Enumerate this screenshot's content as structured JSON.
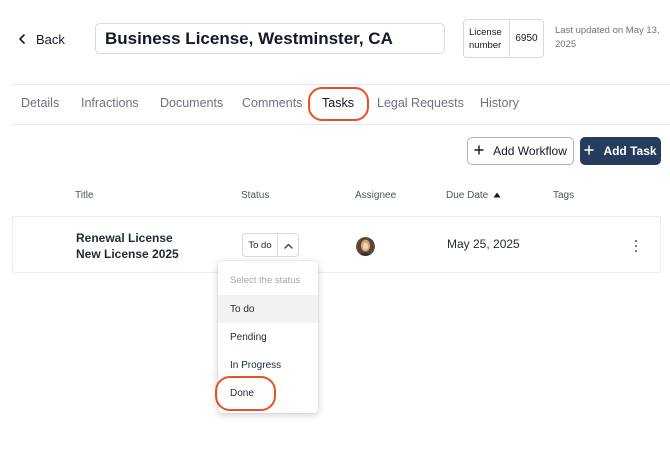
{
  "header": {
    "back_label": "Back",
    "title": "Business License, Westminster, CA",
    "license_label": "License number",
    "license_number": "6950",
    "last_updated": "Last updated on May 13, 2025"
  },
  "tabs": [
    {
      "label": "Details"
    },
    {
      "label": "Infractions"
    },
    {
      "label": "Documents"
    },
    {
      "label": "Comments"
    },
    {
      "label": "Tasks",
      "active": true
    },
    {
      "label": "Legal Requests"
    },
    {
      "label": "History"
    }
  ],
  "actions": {
    "add_workflow": "Add Workflow",
    "add_task": "Add Task"
  },
  "table": {
    "columns": [
      "Title",
      "Status",
      "Assignee",
      "Due Date",
      "Tags"
    ],
    "sort": {
      "column": "Due Date",
      "direction": "ascending"
    },
    "rows": [
      {
        "title_line1": "Renewal License",
        "title_line2": "New License 2025",
        "status": "To do",
        "due_date": "May 25, 2025",
        "tags": ""
      }
    ]
  },
  "status_dropdown": {
    "placeholder": "Select the status",
    "options": [
      "To do",
      "Pending",
      "In Progress",
      "Done"
    ],
    "selected": "To do"
  },
  "colors": {
    "primary": "#263b5e",
    "highlight_circle": "#e8502a",
    "text": "#1f2937",
    "muted": "#6b7280",
    "border": "#d7dbe0"
  },
  "icons": [
    "chevron-left-icon",
    "plus-icon",
    "sort-ascending-icon",
    "chevron-up-icon",
    "more-vertical-icon",
    "avatar"
  ]
}
